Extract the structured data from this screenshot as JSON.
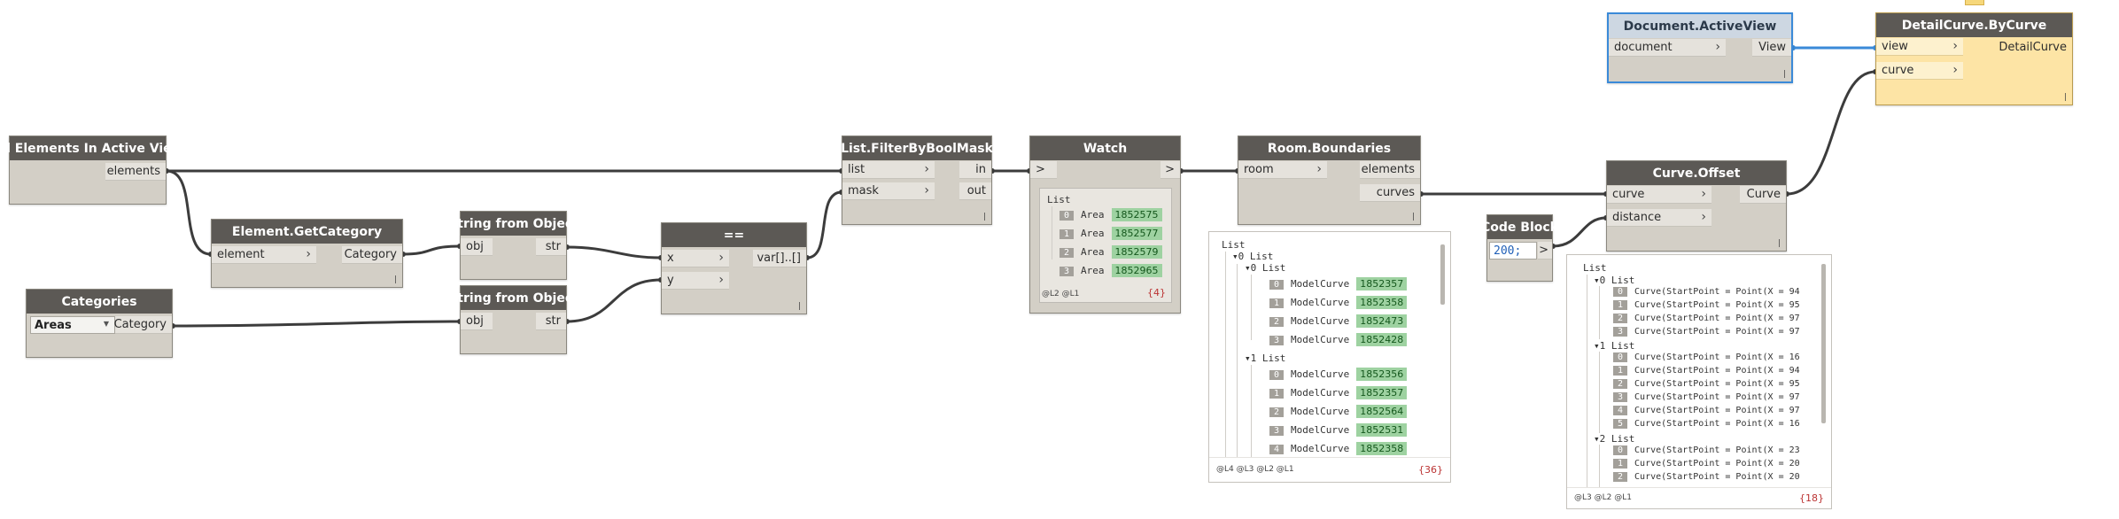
{
  "nodes": {
    "all_elements": {
      "title": "All Elements In Active View",
      "outputs": [
        "elements"
      ]
    },
    "element_getcategory": {
      "title": "Element.GetCategory",
      "inputs": [
        "element"
      ],
      "outputs": [
        "Category"
      ]
    },
    "string_obj_1": {
      "title": "String from Object",
      "inputs": [
        "obj"
      ],
      "outputs": [
        "str"
      ]
    },
    "categories": {
      "title": "Categories",
      "selected": "Areas",
      "outputs": [
        "Category"
      ]
    },
    "string_obj_2": {
      "title": "String from Object",
      "inputs": [
        "obj"
      ],
      "outputs": [
        "str"
      ]
    },
    "equals": {
      "title": "==",
      "inputs": [
        "x",
        "y"
      ],
      "outputs": [
        "var[]..[]"
      ]
    },
    "filter_bool_mask": {
      "title": "List.FilterByBoolMask",
      "inputs": [
        "list",
        "mask"
      ],
      "outputs": [
        "in",
        "out"
      ]
    },
    "watch": {
      "title": "Watch",
      "inputs": [
        ">"
      ],
      "outputs": [
        ">"
      ]
    },
    "room_boundaries": {
      "title": "Room.Boundaries",
      "inputs": [
        "room"
      ],
      "outputs": [
        "elements",
        "curves"
      ]
    },
    "code_block": {
      "title": "Code Block",
      "code": "200;",
      "outputs": [
        ">"
      ]
    },
    "curve_offset": {
      "title": "Curve.Offset",
      "inputs": [
        "curve",
        "distance"
      ],
      "outputs": [
        "Curve"
      ]
    },
    "doc_active_view": {
      "title": "Document.ActiveView",
      "inputs": [
        "document"
      ],
      "outputs": [
        "View"
      ]
    },
    "detail_curve": {
      "title": "DetailCurve.ByCurve",
      "inputs": [
        "view",
        "curve"
      ],
      "outputs": [
        "DetailCurve"
      ]
    }
  },
  "watch_preview": {
    "root": "List",
    "items": [
      {
        "index": "0",
        "type": "Area",
        "id": "1852575"
      },
      {
        "index": "1",
        "type": "Area",
        "id": "1852577"
      },
      {
        "index": "2",
        "type": "Area",
        "id": "1852579"
      },
      {
        "index": "3",
        "type": "Area",
        "id": "1852965"
      }
    ],
    "levels": "@L2 @L1",
    "count": "{4}"
  },
  "room_preview": {
    "root": "List",
    "groups": [
      {
        "label": "0 List",
        "sub": "0 List",
        "items": [
          {
            "index": "0",
            "type": "ModelCurve",
            "id": "1852357"
          },
          {
            "index": "1",
            "type": "ModelCurve",
            "id": "1852358"
          },
          {
            "index": "2",
            "type": "ModelCurve",
            "id": "1852473"
          },
          {
            "index": "3",
            "type": "ModelCurve",
            "id": "1852428"
          }
        ]
      },
      {
        "label": "1 List",
        "items": [
          {
            "index": "0",
            "type": "ModelCurve",
            "id": "1852356"
          },
          {
            "index": "1",
            "type": "ModelCurve",
            "id": "1852357"
          },
          {
            "index": "2",
            "type": "ModelCurve",
            "id": "1852564"
          },
          {
            "index": "3",
            "type": "ModelCurve",
            "id": "1852531"
          },
          {
            "index": "4",
            "type": "ModelCurve",
            "id": "1852358"
          }
        ]
      }
    ],
    "levels": "@L4 @L3 @L2 @L1",
    "count": "{36}"
  },
  "offset_preview": {
    "root": "List",
    "groups": [
      {
        "label": "0 List",
        "items": [
          {
            "index": "0",
            "text": "Curve(StartPoint = Point(X = 94"
          },
          {
            "index": "1",
            "text": "Curve(StartPoint = Point(X = 95"
          },
          {
            "index": "2",
            "text": "Curve(StartPoint = Point(X = 97"
          },
          {
            "index": "3",
            "text": "Curve(StartPoint = Point(X = 97"
          }
        ]
      },
      {
        "label": "1 List",
        "items": [
          {
            "index": "0",
            "text": "Curve(StartPoint = Point(X = 16"
          },
          {
            "index": "1",
            "text": "Curve(StartPoint = Point(X = 94"
          },
          {
            "index": "2",
            "text": "Curve(StartPoint = Point(X = 95"
          },
          {
            "index": "3",
            "text": "Curve(StartPoint = Point(X = 97"
          },
          {
            "index": "4",
            "text": "Curve(StartPoint = Point(X = 97"
          },
          {
            "index": "5",
            "text": "Curve(StartPoint = Point(X = 16"
          }
        ]
      },
      {
        "label": "2 List",
        "items": [
          {
            "index": "0",
            "text": "Curve(StartPoint = Point(X = 23"
          },
          {
            "index": "1",
            "text": "Curve(StartPoint = Point(X = 20"
          },
          {
            "index": "2",
            "text": "Curve(StartPoint = Point(X = 20"
          }
        ]
      }
    ],
    "levels": "@L3 @L2 @L1",
    "count": "{18}"
  },
  "colors": {
    "node_header": "#5c5955",
    "node_body": "#d3cfc6",
    "wire": "#3c3c3c",
    "selected_wire": "#3a8ad8",
    "preview_node": "#fde4a5",
    "value_highlight": "#9ed2a1"
  }
}
